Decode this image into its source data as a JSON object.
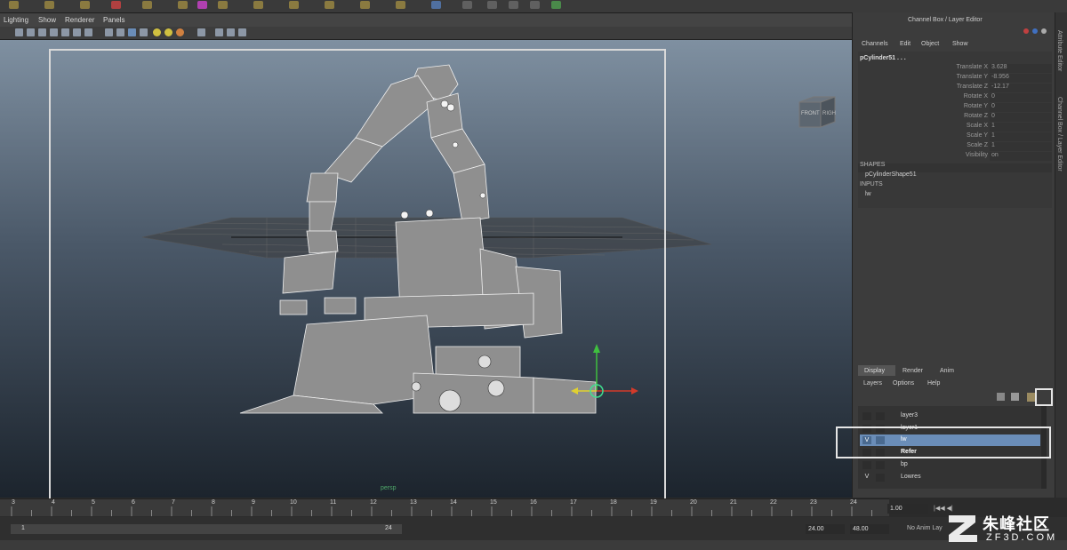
{
  "viewport_menu": [
    "Lighting",
    "Show",
    "Renderer",
    "Panels"
  ],
  "camera_label": "persp",
  "viewcube": {
    "front": "FRONT",
    "right": "RIGH"
  },
  "panel_title": "Channel Box / Layer Editor",
  "channel_menu": [
    "Channels",
    "Edit",
    "Object",
    "Show"
  ],
  "object_name": "pCylinder51 . . .",
  "channels": [
    {
      "name": "Translate X",
      "value": "3.628"
    },
    {
      "name": "Translate Y",
      "value": "-8.956"
    },
    {
      "name": "Translate Z",
      "value": "-12.17"
    },
    {
      "name": "Rotate X",
      "value": "0"
    },
    {
      "name": "Rotate Y",
      "value": "0"
    },
    {
      "name": "Rotate Z",
      "value": "0"
    },
    {
      "name": "Scale X",
      "value": "1"
    },
    {
      "name": "Scale Y",
      "value": "1"
    },
    {
      "name": "Scale Z",
      "value": "1"
    },
    {
      "name": "Visibility",
      "value": "on"
    }
  ],
  "shapes_header": "SHAPES",
  "shape_name": "pCylinderShape51",
  "inputs_header": "INPUTS",
  "input_name": "lw",
  "side_tabs": [
    "Attribute Editor",
    "Channel Box / Layer Editor"
  ],
  "layer_tabs": [
    "Display",
    "Render",
    "Anim"
  ],
  "layer_menu": [
    "Layers",
    "Options",
    "Help"
  ],
  "layers": [
    {
      "name": "layer3",
      "vis": ""
    },
    {
      "name": "layer1",
      "vis": ""
    },
    {
      "name": "lw",
      "vis": "V"
    },
    {
      "name": "Refer",
      "vis": ""
    },
    {
      "name": "bp",
      "vis": ""
    },
    {
      "name": "Lowres",
      "vis": "V"
    }
  ],
  "timeline_ticks": [
    "3",
    "4",
    "5",
    "6",
    "7",
    "8",
    "9",
    "10",
    "11",
    "12",
    "13",
    "14",
    "15",
    "16",
    "17",
    "18",
    "19",
    "20",
    "21",
    "22",
    "23",
    "24"
  ],
  "current_frame": "1.00",
  "range": {
    "start": "1",
    "mid": "24",
    "end_a": "24.00",
    "end_b": "48.00"
  },
  "anim_layer": "No Anim Lay",
  "watermark": {
    "text": "朱峰社区",
    "url": "ZF3D.COM"
  },
  "colors": {
    "selection": "#6a8db8",
    "gizmo_x": "#d23a2a",
    "gizmo_y": "#3fbf3f",
    "gizmo_z": "#e0d030"
  }
}
